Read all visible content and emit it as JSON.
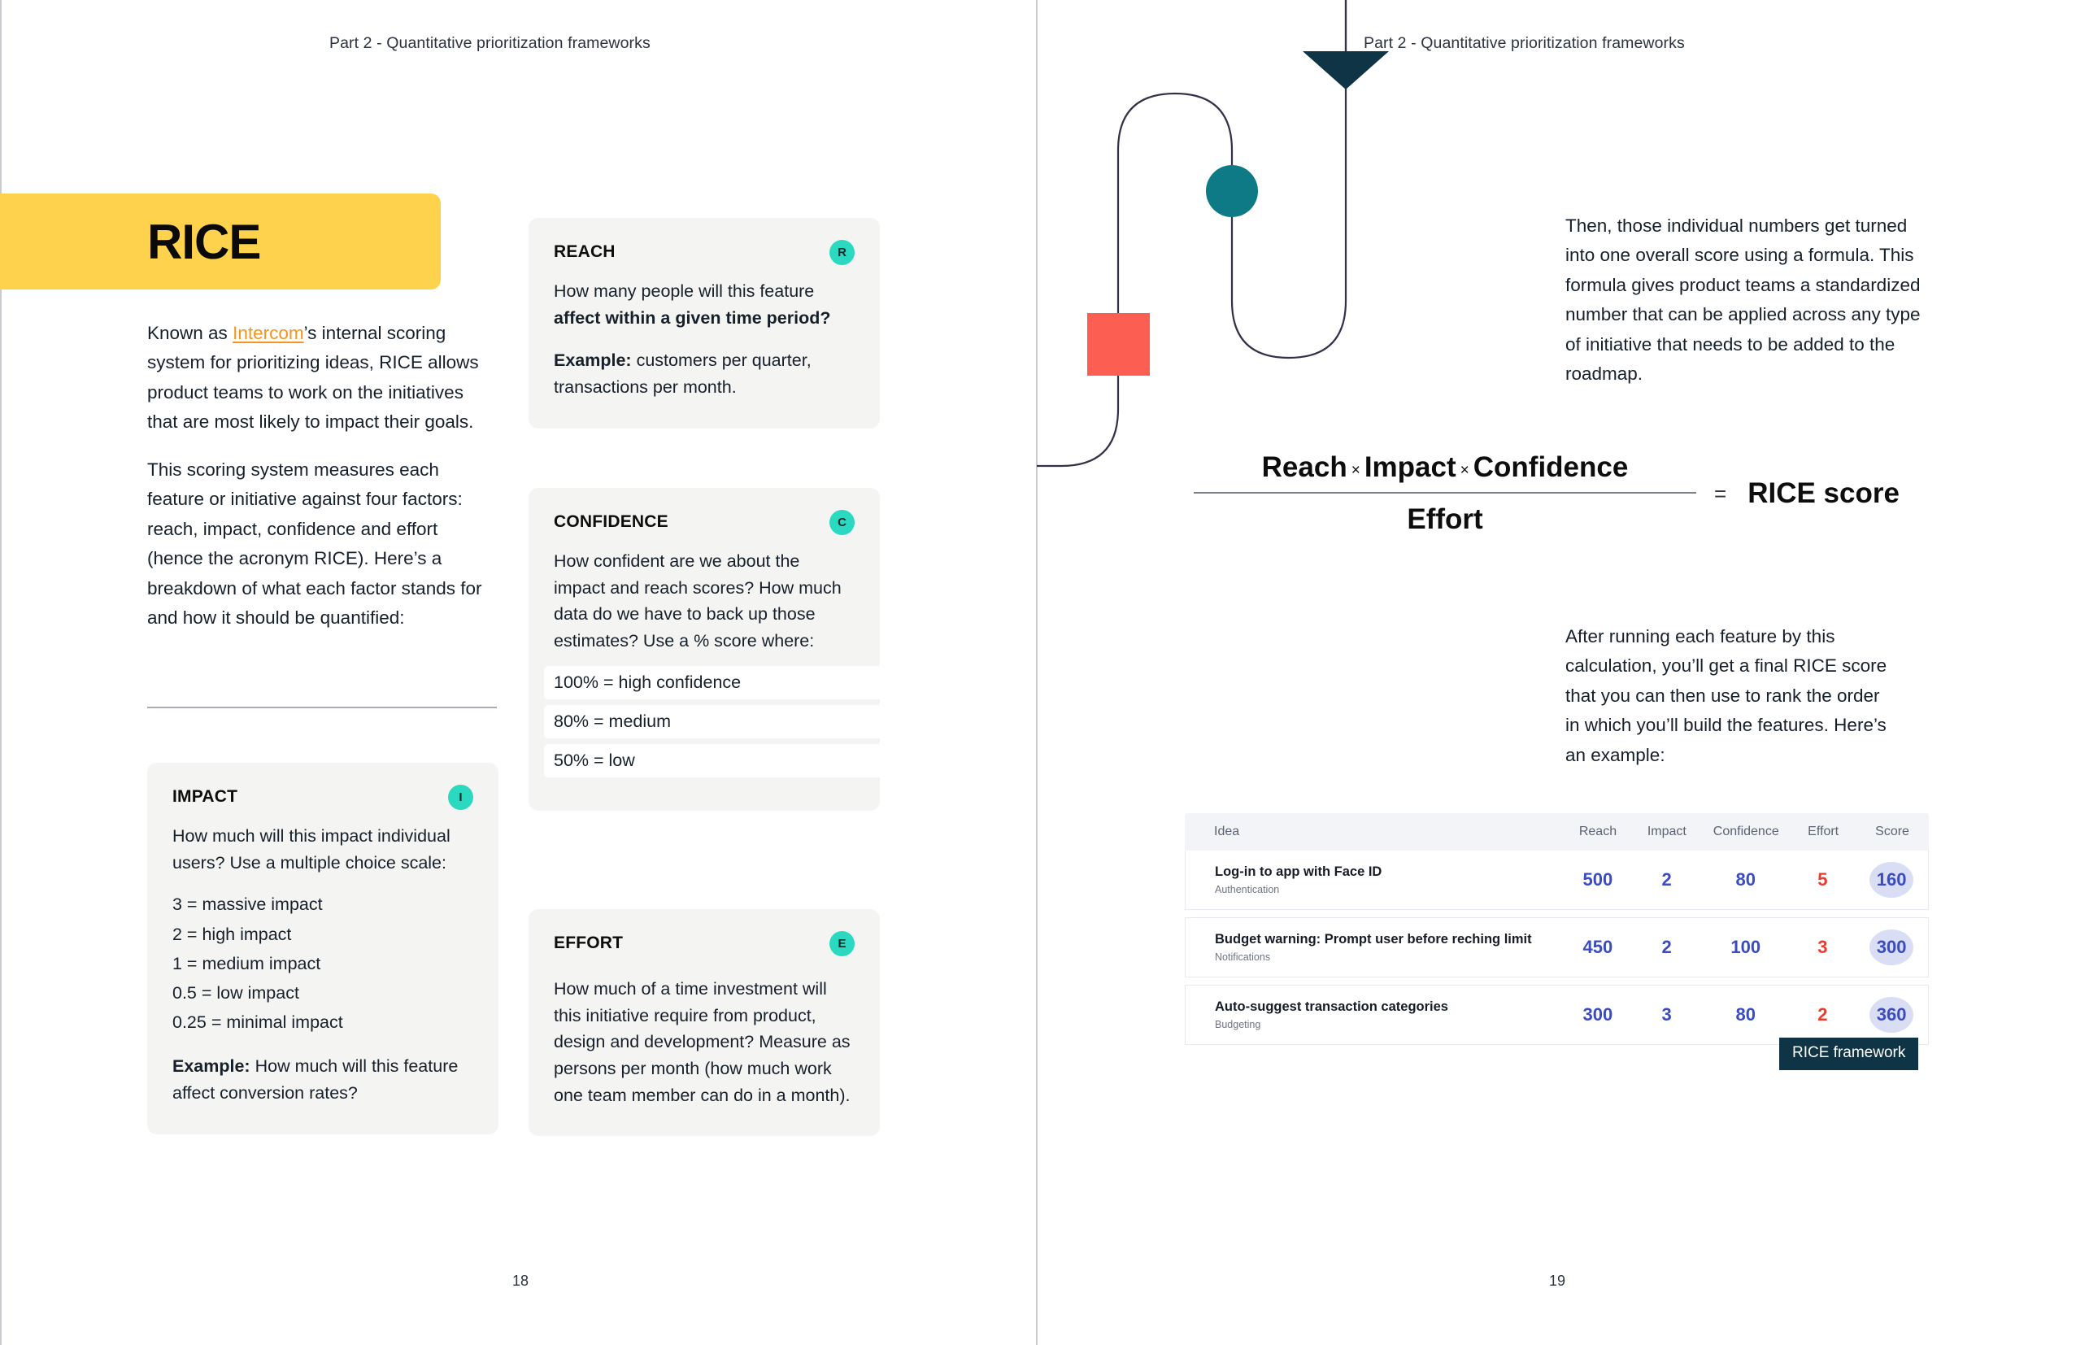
{
  "colors": {
    "banner_yellow": "#ffd24d",
    "badge_teal": "#2bd9c0",
    "link_orange": "#f79420",
    "deco_navy": "#0e3446",
    "deco_teal": "#0d7a85",
    "deco_red": "#fc5f52",
    "stroke_purple": "#33304a",
    "value_blue": "#3a4cc0",
    "value_red": "#ef3b2d",
    "score_pill": "#d9def5",
    "caption_bg": "#0e3446"
  },
  "left_page": {
    "running_head": "Part 2 - Quantitative prioritization frameworks",
    "folio": "18",
    "banner_title": "RICE",
    "paragraphs": [
      {
        "before": "Known as ",
        "link": "Intercom",
        "after": "’s internal scoring system for prioritizing ideas, RICE allows product teams to work on the initiatives that are most likely to impact their goals."
      },
      {
        "text": "This scoring system measures each feature or initiative against four factors: reach, impact, confidence and effort (hence the acronym RICE). Here’s a breakdown of what each factor stands for and how it should be quantified:"
      }
    ]
  },
  "cards": {
    "impact": {
      "title": "IMPACT",
      "badge": "I",
      "intro": "How much will this impact individual users? Use a multiple choice scale:",
      "scale": [
        "3 = massive impact",
        "2 = high impact",
        "1 = medium impact",
        "0.5 = low impact",
        "0.25 = minimal impact"
      ],
      "example_label": "Example:",
      "example_text": " How much will this feature affect conversion rates?"
    },
    "reach": {
      "title": "REACH",
      "badge": "R",
      "question_normal": "How many people will this feature ",
      "question_bold": "affect within a given time period?",
      "example_label": "Example:",
      "example_text": " customers per quarter, transactions per month."
    },
    "confidence": {
      "title": "CONFIDENCE",
      "badge": "C",
      "intro": "How confident are we about the impact and reach scores? How much data do we have to back up those estimates? Use a % score where:",
      "rows": [
        "100% = high confidence",
        "80% = medium",
        "50% = low"
      ]
    },
    "effort": {
      "title": "EFFORT",
      "badge": "E",
      "body": "How much of a time investment will this initiative require from product, design and development? Measure as persons per month (how much work one team member can do in a month)."
    }
  },
  "right_page": {
    "running_head": "Part 2 - Quantitative prioritization frameworks",
    "folio": "19",
    "intro_paragraph": "Then, those individual numbers get turned into one overall score using a formula. This formula gives product teams a standardized number that can be applied across any type of initiative that needs to be added to the roadmap.",
    "after_paragraph": "After running each feature by this calculation, you’ll get a final RICE score that you can then use to rank the order in which you’ll build the features. Here’s an example:",
    "formula": {
      "numerator_1": "Reach",
      "times_1": "×",
      "numerator_2": "Impact",
      "times_2": "×",
      "numerator_3": "Confidence",
      "denominator": "Effort",
      "equals": "=",
      "result": "RICE score"
    },
    "caption": "RICE framework"
  },
  "table": {
    "headers": [
      "Idea",
      "Reach",
      "Impact",
      "Confidence",
      "Effort",
      "Score"
    ],
    "rows": [
      {
        "idea": "Log-in to app with Face ID",
        "category": "Authentication",
        "reach": "500",
        "impact": "2",
        "confidence": "80",
        "effort": "5",
        "score": "160"
      },
      {
        "idea": "Budget warning: Prompt user before reching limit",
        "category": "Notifications",
        "reach": "450",
        "impact": "2",
        "confidence": "100",
        "effort": "3",
        "score": "300"
      },
      {
        "idea": "Auto-suggest transaction categories",
        "category": "Budgeting",
        "reach": "300",
        "impact": "3",
        "confidence": "80",
        "effort": "2",
        "score": "360"
      }
    ]
  }
}
